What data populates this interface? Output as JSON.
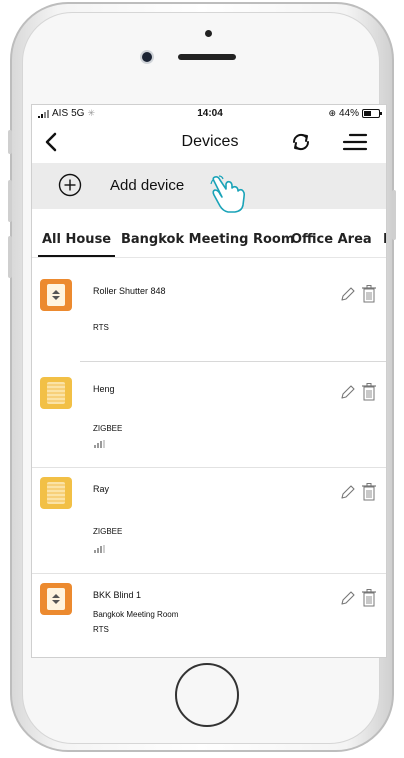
{
  "status_bar": {
    "carrier": "AIS",
    "network": "5G",
    "time": "14:04",
    "battery": "44%"
  },
  "nav": {
    "title": "Devices",
    "icons": [
      "back-chevron-icon",
      "refresh-icon",
      "menu-icon"
    ]
  },
  "add_device": {
    "label": "Add device",
    "icons": [
      "plus-circle-icon",
      "hand-pointer-icon"
    ]
  },
  "tabs": [
    {
      "label": "All House",
      "active": true
    },
    {
      "label": "Bangkok Meeting Room",
      "active": false
    },
    {
      "label": "Office Area",
      "active": false
    },
    {
      "label": "K",
      "active": false
    }
  ],
  "devices": [
    {
      "name": "Roller Shutter 848",
      "room": "",
      "protocol": "RTS",
      "icon": "roller-shutter-icon",
      "icon_color": "#ec8a2f"
    },
    {
      "name": "Heng",
      "room": "",
      "protocol": "ZIGBEE",
      "icon": "blind-icon",
      "icon_color": "#f2c046",
      "signal": true
    },
    {
      "name": "Ray",
      "room": "",
      "protocol": "ZIGBEE",
      "icon": "blind-icon",
      "icon_color": "#f2c046",
      "signal": true
    },
    {
      "name": "BKK Blind 1",
      "room": "Bangkok Meeting Room",
      "protocol": "RTS",
      "icon": "roller-shutter-icon",
      "icon_color": "#ec8a2f"
    }
  ]
}
